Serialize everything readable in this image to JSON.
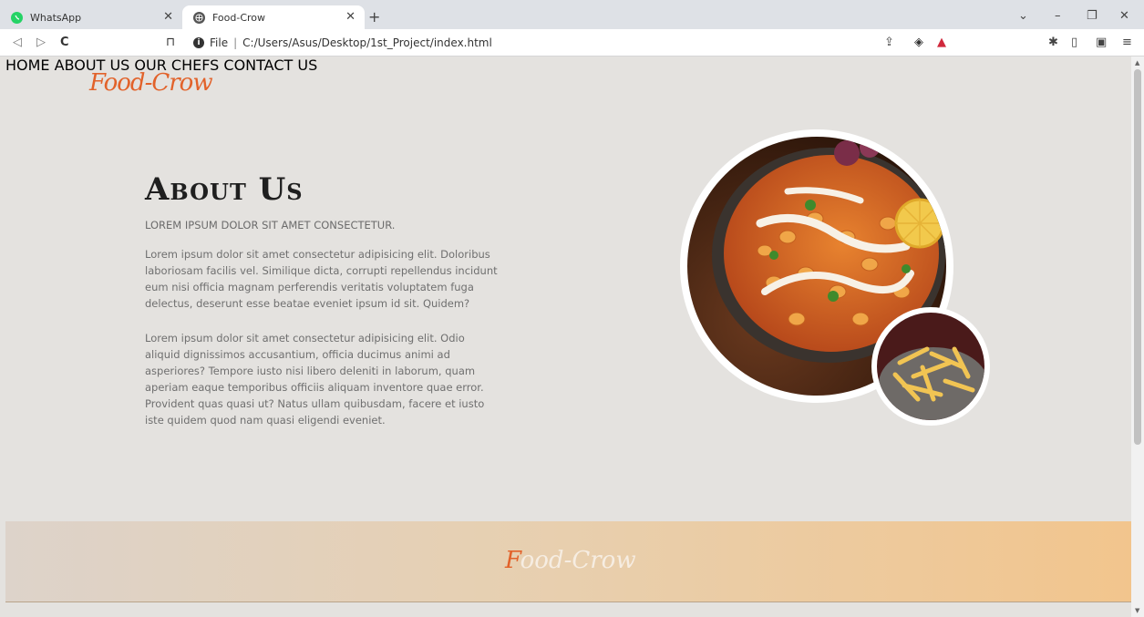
{
  "browser": {
    "tabs": [
      {
        "title": "WhatsApp",
        "favicon": "whatsapp-icon",
        "active": false
      },
      {
        "title": "Food-Crow",
        "favicon": "globe-icon",
        "active": true
      }
    ],
    "address": {
      "scheme": "File",
      "path": "C:/Users/Asus/Desktop/1st_Project/index.html"
    }
  },
  "site": {
    "logo": "Food-Crow",
    "nav": [
      "HOME",
      "ABOUT US",
      "OUR CHEFS",
      "CONTACT US"
    ]
  },
  "about": {
    "title": "About Us",
    "subtitle": "LOREM IPSUM DOLOR SIT AMET CONSECTETUR.",
    "paragraph1": "Lorem ipsum dolor sit amet consectetur adipisicing elit. Doloribus laboriosam facilis vel. Similique dicta, corrupti repellendus incidunt eum nisi officia magnam perferendis veritatis voluptatem fuga delectus, deserunt esse beatae eveniet ipsum id sit. Quidem?",
    "paragraph2": "Lorem ipsum dolor sit amet consectetur adipisicing elit. Odio aliquid dignissimos accusantium, officia ducimus animi ad asperiores? Tempore iusto nisi libero deleniti in laborum, quam aperiam eaque temporibus officiis aliquam inventore quae error. Provident quas quasi ut? Natus ullam quibusdam, facere et iusto iste quidem quod nam quasi eligendi eveniet."
  },
  "footer": {
    "logo_first": "F",
    "logo_rest": "ood-Crow"
  },
  "colors": {
    "accent": "#e2622a",
    "page_bg": "#e4e2df",
    "footer_end": "#f2c58d"
  }
}
